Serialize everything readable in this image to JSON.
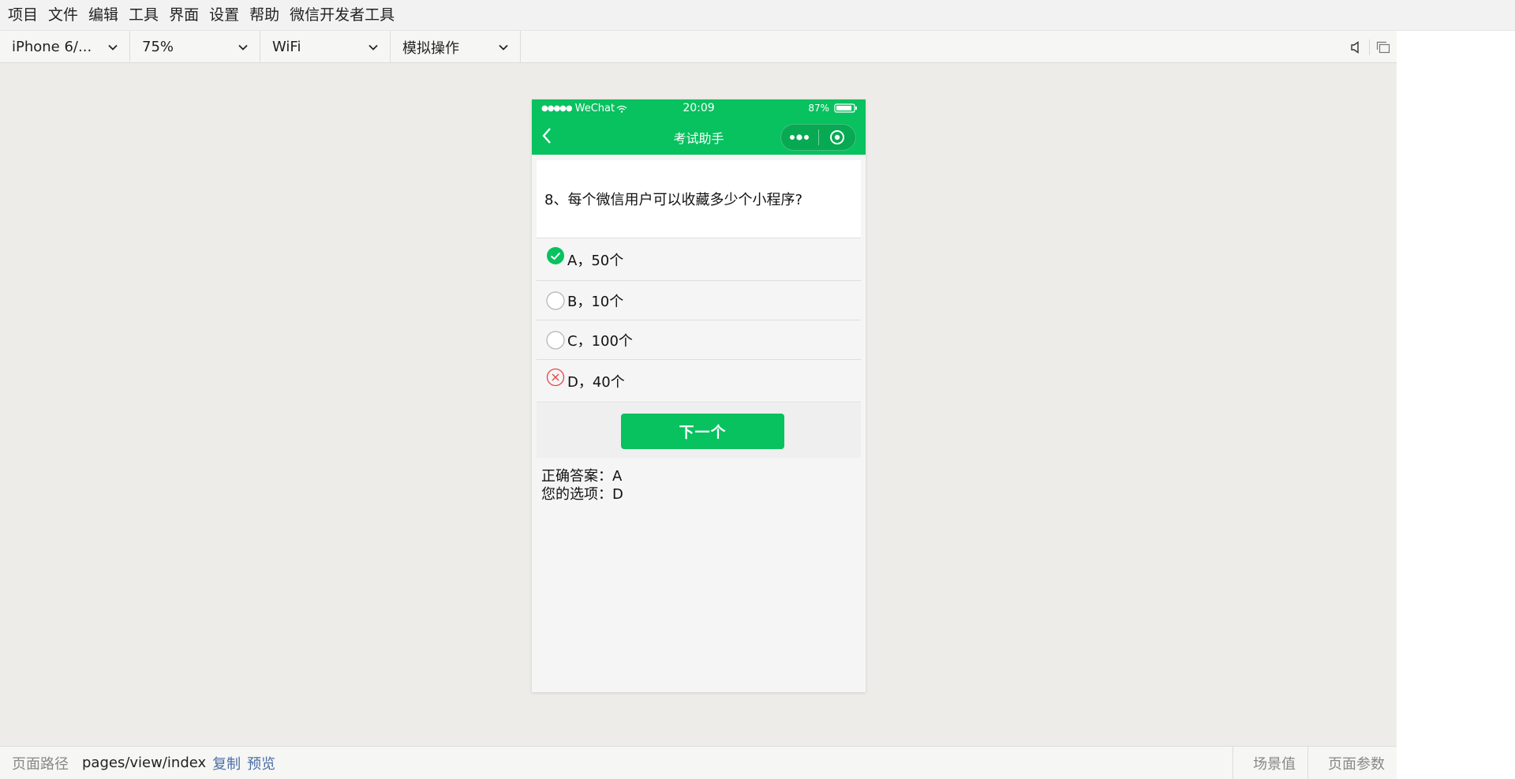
{
  "menu": [
    "项目",
    "文件",
    "编辑",
    "工具",
    "界面",
    "设置",
    "帮助",
    "微信开发者工具"
  ],
  "toolbar": {
    "device": "iPhone 6/...",
    "zoom": "75%",
    "network": "WiFi",
    "operation": "模拟操作"
  },
  "phone": {
    "status": {
      "carrier": "WeChat",
      "time": "20:09",
      "battery": "87%"
    },
    "nav_title": "考试助手",
    "question": "8、每个微信用户可以收藏多少个小程序?",
    "options": [
      {
        "label": "A，50个",
        "state": "correct"
      },
      {
        "label": "B，10个",
        "state": "empty"
      },
      {
        "label": "C，100个",
        "state": "empty"
      },
      {
        "label": "D，40个",
        "state": "wrong"
      }
    ],
    "next_button": "下一个",
    "correct_answer": "正确答案：A",
    "your_choice": "您的选项：D"
  },
  "bottom": {
    "path_label": "页面路径",
    "path_value": "pages/view/index",
    "copy": "复制",
    "preview": "预览",
    "scene": "场景值",
    "params": "页面参数"
  },
  "colors": {
    "accent": "#08c15f",
    "wrong": "#e64340",
    "link": "#4a6fa5"
  }
}
